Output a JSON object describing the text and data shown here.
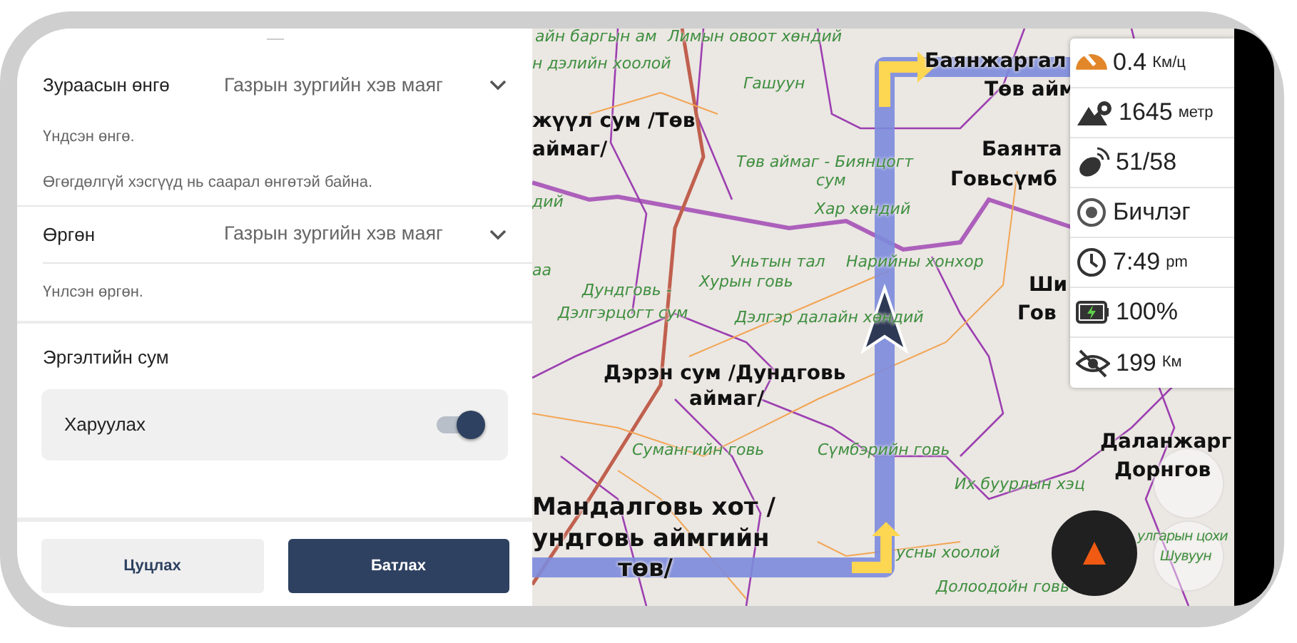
{
  "settings": {
    "sections": [
      {
        "kind": "select",
        "label": "Зураасын өнгө",
        "value": "Газрын зургийн хэв маяг",
        "notes": [
          "Үндсэн өнгө.",
          "Өгөгдөлгүй хэсгүүд нь саарал өнгөтэй байна."
        ]
      },
      {
        "kind": "select",
        "label": "Өргөн",
        "value": "Газрын зургийн хэв маяг",
        "notes": [
          "Үнлсэн өргөн."
        ]
      },
      {
        "kind": "toggle",
        "label": "Эргэлтийн сум",
        "toggle": {
          "label": "Харуулах",
          "on": true
        }
      }
    ],
    "buttons": [
      {
        "label": "Цуцлах",
        "kind": "secondary"
      },
      {
        "label": "Батлах",
        "kind": "primary"
      }
    ]
  },
  "map": {
    "labels": [
      {
        "text": "айн баргын ам",
        "kind": "area"
      },
      {
        "text": "Лимын овоот хөндий",
        "kind": "area"
      },
      {
        "text": "н дэлийн хоолой",
        "kind": "area"
      },
      {
        "text": "Баянжаргал",
        "kind": "city"
      },
      {
        "text": "Гашуун",
        "kind": "area"
      },
      {
        "text": "Төв айм",
        "kind": "city"
      },
      {
        "text": "жүүл сум /Төв",
        "kind": "city"
      },
      {
        "text": "аймаг/",
        "kind": "city"
      },
      {
        "text": "Баянта",
        "kind": "city"
      },
      {
        "text": "Төв аймаг - Биянцогт",
        "kind": "area"
      },
      {
        "text": "Говьсүмб",
        "kind": "city"
      },
      {
        "text": "сум",
        "kind": "area"
      },
      {
        "text": "дий",
        "kind": "area"
      },
      {
        "text": "Хар хөндий",
        "kind": "area"
      },
      {
        "text": "Уньтын тал",
        "kind": "area"
      },
      {
        "text": "Нарийны хонхор",
        "kind": "area"
      },
      {
        "text": "аа",
        "kind": "area"
      },
      {
        "text": "Дундговь -",
        "kind": "area"
      },
      {
        "text": "Хурын говь",
        "kind": "area"
      },
      {
        "text": "Ши",
        "kind": "city"
      },
      {
        "text": "Дэлгэрцогт сум",
        "kind": "area"
      },
      {
        "text": "Дэлгэр далайн хөндий",
        "kind": "area"
      },
      {
        "text": "Гов",
        "kind": "city"
      },
      {
        "text": "Дэрэн сум /Дундговь",
        "kind": "city"
      },
      {
        "text": "аймаг/",
        "kind": "city"
      },
      {
        "text": "Даланжарг",
        "kind": "city"
      },
      {
        "text": "Сумангийн говь",
        "kind": "area"
      },
      {
        "text": "Сүмбэрийн говь",
        "kind": "area"
      },
      {
        "text": "Дорнгов",
        "kind": "city"
      },
      {
        "text": "Их буурлын хэц",
        "kind": "area"
      },
      {
        "text": "Мандалговь хот /",
        "kind": "capital"
      },
      {
        "text": "ундговь аймгийн",
        "kind": "capital"
      },
      {
        "text": "улгарын цохи",
        "kind": "area"
      },
      {
        "text": "усны хоолой",
        "kind": "area"
      },
      {
        "text": "Шувуун",
        "kind": "area"
      },
      {
        "text": "төв/",
        "kind": "capital"
      },
      {
        "text": "Долоодойн говь",
        "kind": "area"
      }
    ],
    "widgets": [
      {
        "kind": "speed",
        "value": "0.4",
        "unit": "Км/ц"
      },
      {
        "kind": "altitude",
        "value": "1645",
        "unit": "метр"
      },
      {
        "kind": "satellites",
        "value": "51/58"
      },
      {
        "kind": "record",
        "value": "Бичлэг"
      },
      {
        "kind": "clock",
        "value": "7:49",
        "unit": "pm"
      },
      {
        "kind": "battery",
        "value": "100%"
      },
      {
        "kind": "hidden",
        "value": "199",
        "unit": "Км"
      }
    ]
  }
}
